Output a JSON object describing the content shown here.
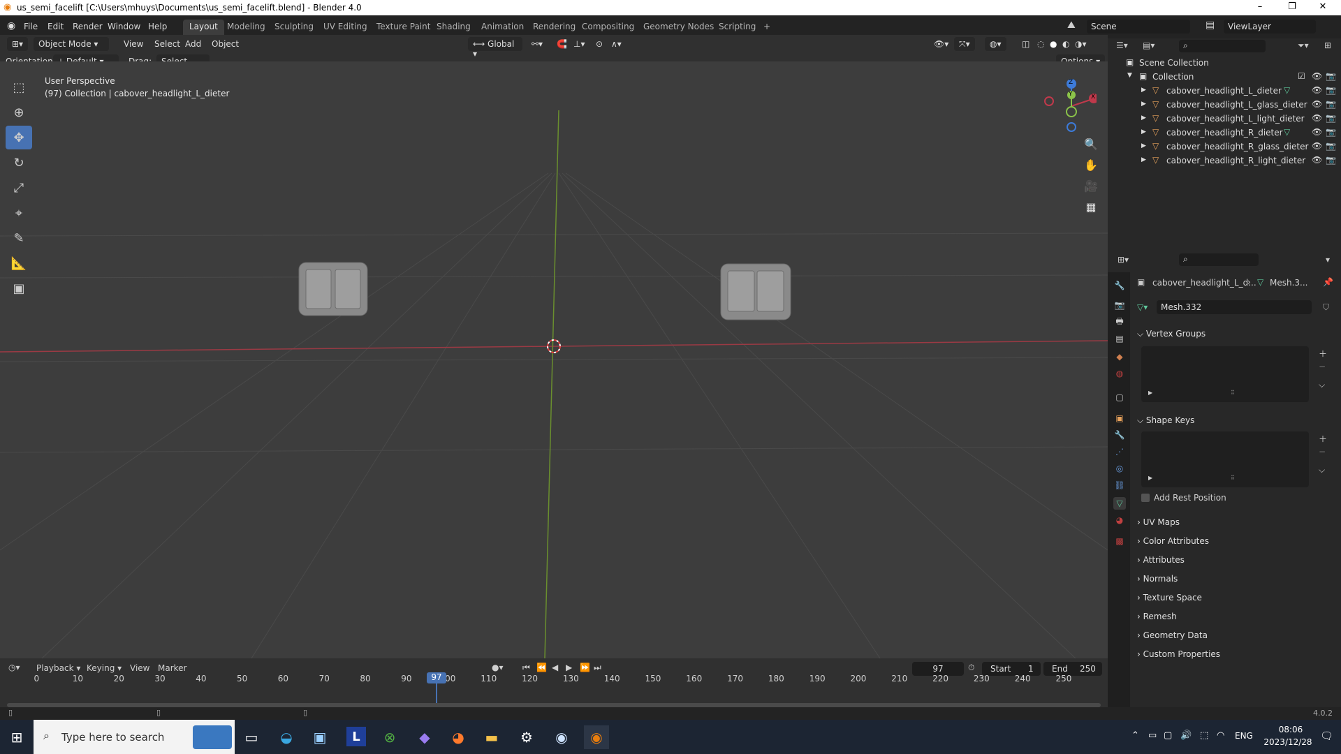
{
  "title_bar": {
    "title": "us_semi_facelift [C:\\Users\\mhuys\\Documents\\us_semi_facelift.blend] - Blender 4.0",
    "minimize": "–",
    "maximize": "❐",
    "close": "✕"
  },
  "menu": {
    "file": "File",
    "edit": "Edit",
    "render": "Render",
    "window": "Window",
    "help": "Help"
  },
  "workspaces": [
    "Layout",
    "Modeling",
    "Sculpting",
    "UV Editing",
    "Texture Paint",
    "Shading",
    "Animation",
    "Rendering",
    "Compositing",
    "Geometry Nodes",
    "Scripting",
    "+"
  ],
  "active_workspace": "Layout",
  "scene": {
    "name": "Scene",
    "view_layer": "ViewLayer"
  },
  "viewport_header": {
    "mode": "Object Mode",
    "view": "View",
    "select": "Select",
    "add": "Add",
    "object": "Object",
    "transform": "Global",
    "options": "Options"
  },
  "tool_settings": {
    "orientation_label": "Orientation:",
    "orientation_value": "Default",
    "drag_label": "Drag:",
    "drag_value": "Select Box"
  },
  "viewport": {
    "perspective": "User Perspective",
    "collection_info": "(97) Collection | cabover_headlight_L_dieter",
    "gizmo_z": "Z",
    "gizmo_y": "Y",
    "gizmo_x": "X"
  },
  "outliner": {
    "scene_collection": "Scene Collection",
    "collection": "Collection",
    "items": [
      {
        "name": "cabover_headlight_L_dieter"
      },
      {
        "name": "cabover_headlight_L_glass_dieter"
      },
      {
        "name": "cabover_headlight_L_light_dieter"
      },
      {
        "name": "cabover_headlight_R_dieter"
      },
      {
        "name": "cabover_headlight_R_glass_dieter"
      },
      {
        "name": "cabover_headlight_R_light_dieter"
      }
    ]
  },
  "properties": {
    "breadcrumb_object": "cabover_headlight_L_d...",
    "breadcrumb_mesh": "Mesh.3...",
    "mesh_name": "Mesh.332",
    "vertex_groups": "Vertex Groups",
    "shape_keys": "Shape Keys",
    "add_rest_position": "Add Rest Position",
    "collapsed_panels": [
      "UV Maps",
      "Color Attributes",
      "Attributes",
      "Normals",
      "Texture Space",
      "Remesh",
      "Geometry Data",
      "Custom Properties"
    ]
  },
  "timeline": {
    "playback": "Playback",
    "keying": "Keying",
    "view": "View",
    "marker": "Marker",
    "current_frame": "97",
    "start_label": "Start",
    "start": "1",
    "end_label": "End",
    "end": "250",
    "ticks": [
      "0",
      "10",
      "20",
      "30",
      "40",
      "50",
      "60",
      "70",
      "80",
      "90",
      "100",
      "110",
      "120",
      "130",
      "140",
      "150",
      "160",
      "170",
      "180",
      "190",
      "200",
      "210",
      "220",
      "230",
      "240",
      "250"
    ],
    "playhead_label": "97"
  },
  "status": {
    "version": "4.0.2"
  },
  "taskbar": {
    "search_placeholder": "Type here to search",
    "time": "08:06",
    "date": "2023/12/28",
    "lang": "ENG"
  },
  "colors": {
    "accent": "#4772b3",
    "x_axis": "#c0394b",
    "y_axis": "#8bc34a",
    "z_axis": "#3d7bd9"
  }
}
